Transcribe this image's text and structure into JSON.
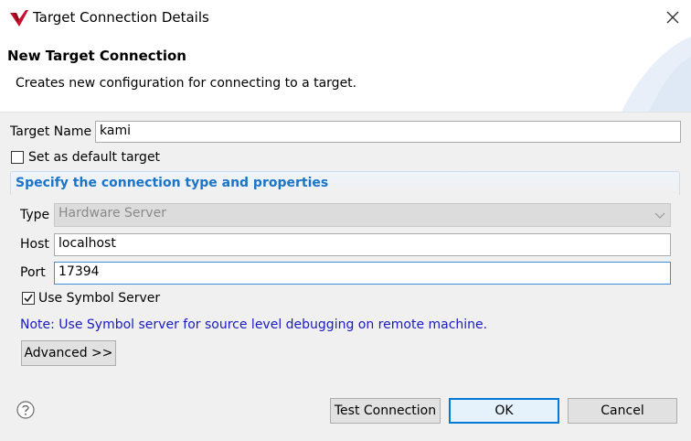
{
  "window": {
    "title": "Target Connection Details"
  },
  "header": {
    "title": "New Target Connection",
    "description": "Creates new configuration for connecting to a target."
  },
  "target": {
    "name_label": "Target Name",
    "name_value": "kami",
    "default_label": "Set as default target",
    "default_checked": false
  },
  "connection": {
    "section_title": "Specify the connection type and properties",
    "type_label": "Type",
    "type_value": "Hardware Server",
    "host_label": "Host",
    "host_value": "localhost",
    "port_label": "Port",
    "port_value": "17394",
    "symbol_label": "Use Symbol Server",
    "symbol_checked": true,
    "note": "Note: Use Symbol server for source level debugging on remote machine.",
    "advanced_label": "Advanced >>"
  },
  "footer": {
    "test_label": "Test Connection",
    "ok_label": "OK",
    "cancel_label": "Cancel"
  },
  "icons": {
    "app": "vitis-logo-icon",
    "close": "close-icon",
    "help": "help-icon",
    "dropdown": "chevron-down-icon",
    "check": "check-icon"
  },
  "colors": {
    "section_title": "#1a74c8",
    "note": "#1a1ac0",
    "focus_border": "#3c8fd8",
    "default_button_border": "#0078d7"
  }
}
